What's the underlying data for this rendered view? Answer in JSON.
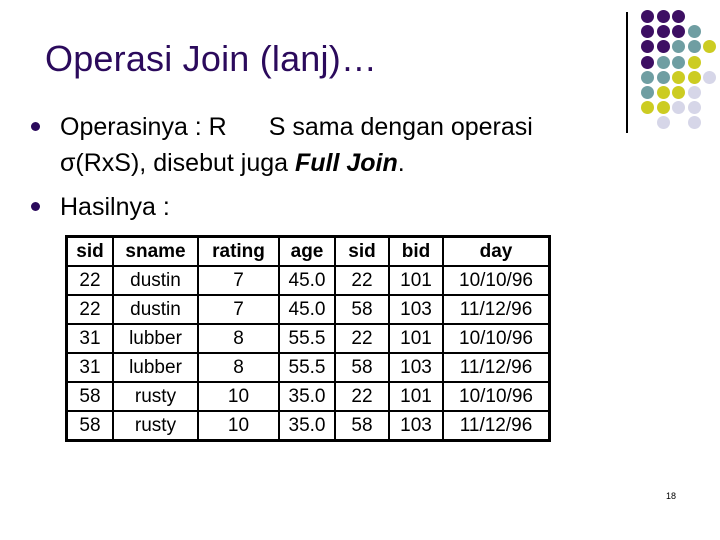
{
  "slide": {
    "title": "Operasi Join (lanj)…",
    "page_number": "18",
    "accent_color": "#2b0a5c",
    "decor_colors": {
      "purple": "#3d0f63",
      "teal": "#6f9ea2",
      "yellow": "#cccc22",
      "lavender": "#d6d6e8"
    }
  },
  "bullets": [
    {
      "icon": "bullet-dot-icon",
      "line1_pre": "Operasinya : R",
      "join_symbol_hidden": "⋈",
      "line1_post": "S sama dengan operasi",
      "line2_pre": "σ(RxS), disebut juga ",
      "line2_emph": "Full Join",
      "line2_post": "."
    },
    {
      "icon": "bullet-dot-icon",
      "text": "Hasilnya :"
    }
  ],
  "table": {
    "headers": [
      "sid",
      "sname",
      "rating",
      "age",
      "sid",
      "bid",
      "day"
    ],
    "rows": [
      [
        "22",
        "dustin",
        "7",
        "45.0",
        "22",
        "101",
        "10/10/96"
      ],
      [
        "22",
        "dustin",
        "7",
        "45.0",
        "58",
        "103",
        "11/12/96"
      ],
      [
        "31",
        "lubber",
        "8",
        "55.5",
        "22",
        "101",
        "10/10/96"
      ],
      [
        "31",
        "lubber",
        "8",
        "55.5",
        "58",
        "103",
        "11/12/96"
      ],
      [
        "58",
        "rusty",
        "10",
        "35.0",
        "22",
        "101",
        "10/10/96"
      ],
      [
        "58",
        "rusty",
        "10",
        "35.0",
        "58",
        "103",
        "11/12/96"
      ]
    ]
  }
}
